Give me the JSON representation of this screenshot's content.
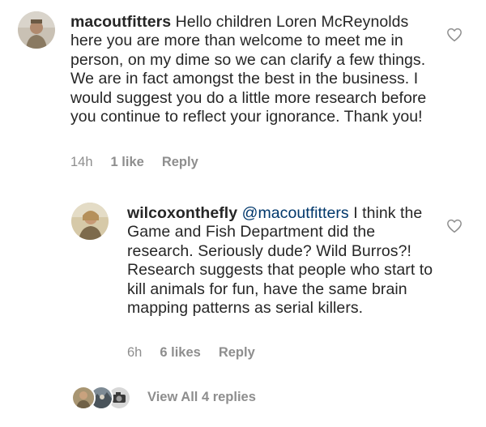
{
  "comments": [
    {
      "username": "macoutfitters",
      "text": " Hello children Loren McReynolds here you are more than welcome to meet me in person, on my dime so we can clarify a few things. We are in fact amongst the best in the business. I would suggest you do a little more research before you continue to reflect your ignorance. Thank you!",
      "time": "14h",
      "likes": "1 like",
      "reply_label": "Reply",
      "avatar_icon": "user-photo-avatar",
      "like_icon": "heart-outline-icon"
    },
    {
      "username": "wilcoxonthefly",
      "mention": "@macoutfitters",
      "text": " I think the Game and Fish Department did the research. Seriously dude? Wild Burros?! Research suggests that people who start to kill animals for fun, have the same brain mapping patterns as serial killers.",
      "time": "6h",
      "likes": "6 likes",
      "reply_label": "Reply",
      "avatar_icon": "user-photo-avatar",
      "like_icon": "heart-outline-icon"
    }
  ],
  "view_replies": {
    "label": "View All 4 replies",
    "avatar_icons": [
      "user-photo-avatar",
      "user-photo-avatar",
      "user-photo-avatar"
    ]
  },
  "colors": {
    "text": "#262626",
    "secondary": "#8e8e8e",
    "mention": "#00376b",
    "background": "#ffffff"
  }
}
